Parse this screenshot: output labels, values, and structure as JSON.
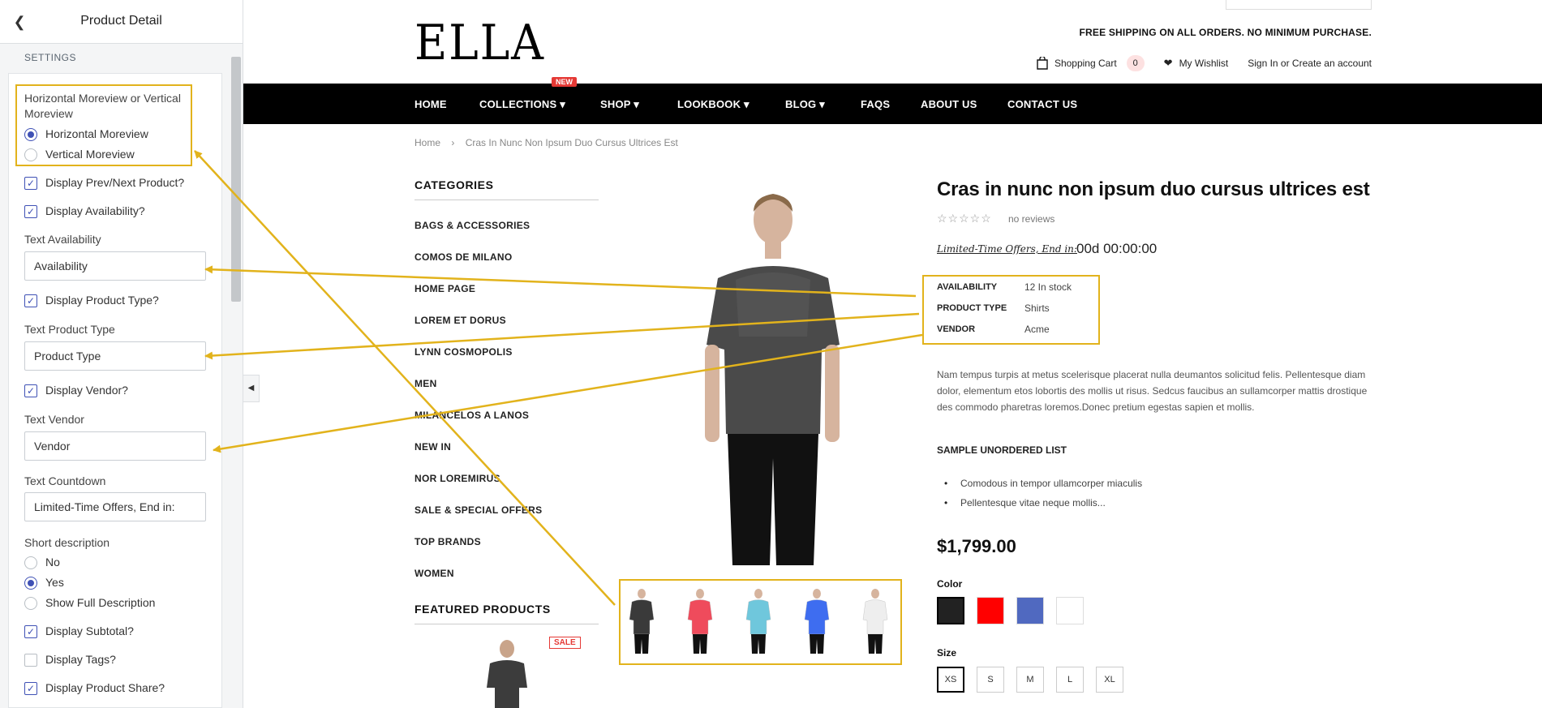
{
  "panel": {
    "title": "Product Detail",
    "section": "SETTINGS",
    "moreview_label": "Horizontal Moreview or Vertical Moreview",
    "moreview_options": [
      "Horizontal Moreview",
      "Vertical Moreview"
    ],
    "moreview_selected": "Horizontal Moreview",
    "checks": {
      "prev_next": {
        "label": "Display Prev/Next Product?",
        "checked": true
      },
      "availability": {
        "label": "Display Availability?",
        "checked": true
      },
      "product_type": {
        "label": "Display Product Type?",
        "checked": true
      },
      "vendor": {
        "label": "Display Vendor?",
        "checked": true
      },
      "subtotal": {
        "label": "Display Subtotal?",
        "checked": true
      },
      "tags": {
        "label": "Display Tags?",
        "checked": false
      },
      "share": {
        "label": "Display Product Share?",
        "checked": true
      }
    },
    "text_availability": {
      "label": "Text Availability",
      "value": "Availability"
    },
    "text_product_type": {
      "label": "Text Product Type",
      "value": "Product Type"
    },
    "text_vendor": {
      "label": "Text Vendor",
      "value": "Vendor"
    },
    "text_countdown": {
      "label": "Text Countdown",
      "value": "Limited-Time Offers, End in:"
    },
    "short_desc": {
      "label": "Short description",
      "options": [
        "No",
        "Yes",
        "Show Full Description"
      ],
      "selected": "Yes"
    }
  },
  "store": {
    "logo": "ELLA",
    "freeship": "FREE SHIPPING ON ALL ORDERS. NO MINIMUM PURCHASE.",
    "cart_label": "Shopping Cart",
    "cart_count": "0",
    "wishlist": "My Wishlist",
    "signin": "Sign In or Create an account",
    "nav": [
      "HOME",
      "COLLECTIONS",
      "SHOP",
      "LOOKBOOK",
      "BLOG",
      "FAQS",
      "ABOUT US",
      "CONTACT US"
    ],
    "new_tag": "NEW",
    "breadcrumb": {
      "home": "Home",
      "sep": "›",
      "current": "Cras In Nunc Non Ipsum Duo Cursus Ultrices Est"
    },
    "categories_title": "CATEGORIES",
    "categories": [
      "BAGS & ACCESSORIES",
      "COMOS DE MILANO",
      "HOME PAGE",
      "LOREM ET DORUS",
      "LYNN COSMOPOLIS",
      "MEN",
      "MILANCELOS A LANOS",
      "NEW IN",
      "NOR LOREMIRUS",
      "SALE & SPECIAL OFFERS",
      "TOP BRANDS",
      "WOMEN"
    ],
    "featured_title": "FEATURED PRODUCTS",
    "sale_tag": "SALE"
  },
  "product": {
    "title": "Cras in nunc non ipsum duo cursus ultrices est",
    "rating_stars": "☆☆☆☆☆",
    "reviews": "no reviews",
    "countdown_label": "Limited-Time Offers, End in:",
    "countdown_value": "00d 00:00:00",
    "specs": [
      {
        "key": "AVAILABILITY",
        "value": "12 In stock"
      },
      {
        "key": "PRODUCT TYPE",
        "value": "Shirts"
      },
      {
        "key": "VENDOR",
        "value": "Acme"
      }
    ],
    "description": "Nam tempus turpis at metus scelerisque placerat nulla deumantos solicitud felis. Pellentesque diam dolor, elementum etos lobortis des mollis ut risus. Sedcus faucibus an sullamcorper mattis drostique des commodo pharetras loremos.Donec pretium egestas sapien et mollis.",
    "list_title": "SAMPLE UNORDERED LIST",
    "list_items": [
      "Comodous in tempor ullamcorper miaculis",
      "Pellentesque vitae neque mollis..."
    ],
    "price": "$1,799.00",
    "color_label": "Color",
    "colors": [
      "#222222",
      "#ff0000",
      "#5069c0",
      "#ffffff"
    ],
    "size_label": "Size",
    "sizes": [
      "XS",
      "S",
      "M",
      "L",
      "XL"
    ],
    "selected_size": "XS",
    "thumb_colors": [
      "#3a3a3a",
      "#ef4b5c",
      "#6fc7dc",
      "#3e6df0",
      "#eeeeee"
    ]
  },
  "accent_color": "#e2b31c"
}
